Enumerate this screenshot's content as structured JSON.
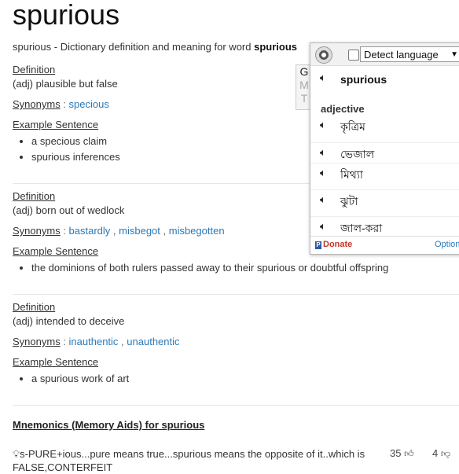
{
  "title": "spurious",
  "subtitle": {
    "prefix": "spurious - Dictionary definition and meaning for word ",
    "word": "spurious"
  },
  "labels": {
    "definition": "Definition",
    "synonyms": "Synonyms",
    "example": "Example Sentence",
    "colon": " : ",
    "comma": " , "
  },
  "senses": [
    {
      "definition": "(adj) plausible but false",
      "synonyms": [
        "specious"
      ],
      "examples": [
        "a specious claim",
        "spurious inferences"
      ]
    },
    {
      "definition": "(adj) born out of wedlock",
      "synonyms": [
        "bastardly",
        "misbegot",
        "misbegotten"
      ],
      "examples": [
        "the dominions of both rulers passed away to their spurious or doubtful offspring"
      ]
    },
    {
      "definition": "(adj) intended to deceive",
      "synonyms": [
        "inauthentic",
        "unauthentic"
      ],
      "examples": [
        "a spurious work of art"
      ]
    }
  ],
  "mnemonics": {
    "heading": "Mnemonics (Memory Aids) for spurious",
    "items": [
      {
        "text": "s-PURE+ious...pure means true...spurious means the opposite of it..which is FALSE,CONTERFEIT",
        "up": "35",
        "down": "4"
      }
    ]
  },
  "popup": {
    "detect_label": "Detect language",
    "gmt": [
      "G",
      "M",
      "T"
    ],
    "word": "spurious",
    "pos": "adjective",
    "translations": [
      "কৃত্রিম",
      "ভেজাল",
      "মিথ্যা",
      "ঝুটা",
      "জাল-করা"
    ],
    "donate": "Donate",
    "options": "Options"
  },
  "icons": {
    "speaker": "speaker-icon",
    "gear": "gear-icon",
    "bulb": "lightbulb-icon",
    "thumb_up": "thumbs-up-icon",
    "thumb_down": "thumbs-down-icon"
  },
  "colors": {
    "link": "#2a7ab8",
    "donate": "#c0392b"
  }
}
